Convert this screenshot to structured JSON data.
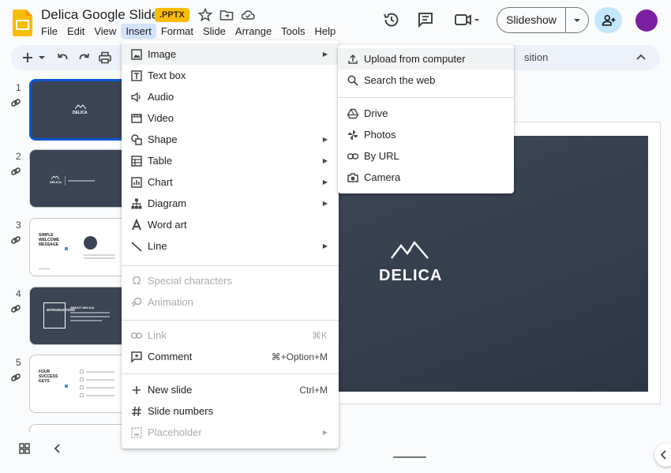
{
  "header": {
    "title": "Delica Google Slide",
    "badge": ".PPTX",
    "menus": [
      "File",
      "Edit",
      "View",
      "Insert",
      "Format",
      "Slide",
      "Arrange",
      "Tools",
      "Help"
    ],
    "slideshow_label": "Slideshow"
  },
  "toolbar": {
    "partial_text": "sition"
  },
  "slides": [
    {
      "number": "1",
      "title": "DELICA"
    },
    {
      "number": "2",
      "title": "DELICA"
    },
    {
      "number": "3",
      "title": "SIMPLE WELCOME MESSAGE"
    },
    {
      "number": "4",
      "title": "INTRODUCTION!",
      "subtitle": "ABOUT DELICA"
    },
    {
      "number": "5",
      "title": "FOUR SUCCESS KEYS"
    }
  ],
  "canvas": {
    "brand": "DELICA"
  },
  "insert_menu": {
    "items": [
      {
        "label": "Image",
        "icon": "image-icon",
        "submenu": true
      },
      {
        "label": "Text box",
        "icon": "text-box-icon"
      },
      {
        "label": "Audio",
        "icon": "audio-icon"
      },
      {
        "label": "Video",
        "icon": "video-icon"
      },
      {
        "label": "Shape",
        "icon": "shape-icon",
        "submenu": true
      },
      {
        "label": "Table",
        "icon": "table-icon",
        "submenu": true
      },
      {
        "label": "Chart",
        "icon": "chart-icon",
        "submenu": true
      },
      {
        "label": "Diagram",
        "icon": "diagram-icon",
        "submenu": true
      },
      {
        "label": "Word art",
        "icon": "word-art-icon"
      },
      {
        "label": "Line",
        "icon": "line-icon",
        "submenu": true
      },
      {
        "label": "Special characters",
        "icon": "omega-icon",
        "disabled": true
      },
      {
        "label": "Animation",
        "icon": "animation-icon",
        "disabled": true
      },
      {
        "label": "Link",
        "icon": "link-icon",
        "disabled": true,
        "shortcut": "⌘K"
      },
      {
        "label": "Comment",
        "icon": "comment-icon",
        "shortcut": "⌘+Option+M"
      },
      {
        "label": "New slide",
        "icon": "plus-icon",
        "shortcut": "Ctrl+M"
      },
      {
        "label": "Slide numbers",
        "icon": "hash-icon"
      },
      {
        "label": "Placeholder",
        "icon": "placeholder-icon",
        "disabled": true,
        "submenu": true
      }
    ],
    "arrow": "▶"
  },
  "image_submenu": {
    "items": [
      {
        "label": "Upload from computer",
        "icon": "upload-icon"
      },
      {
        "label": "Search the web",
        "icon": "search-icon"
      },
      {
        "label": "Drive",
        "icon": "drive-icon"
      },
      {
        "label": "Photos",
        "icon": "photos-icon"
      },
      {
        "label": "By URL",
        "icon": "link-icon"
      },
      {
        "label": "Camera",
        "icon": "camera-icon"
      }
    ]
  }
}
